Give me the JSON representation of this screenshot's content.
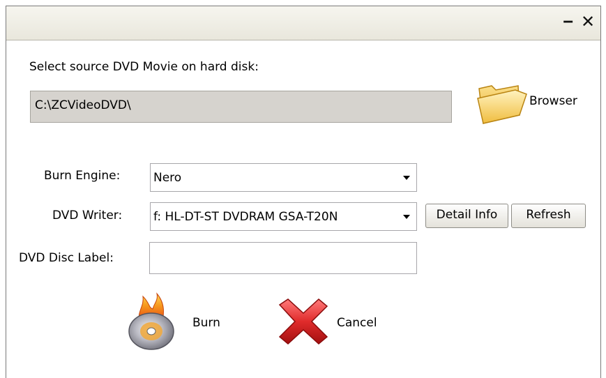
{
  "titlebar": {
    "minimize_glyph": "‒",
    "close_glyph": "✕"
  },
  "source": {
    "label": "Select source DVD Movie on hard disk:",
    "path_value": "C:\\ZCVideoDVD\\",
    "browse_label": "Browser",
    "browse_icon": "folder-icon"
  },
  "burn_engine": {
    "label": "Burn Engine:",
    "selected": "Nero"
  },
  "dvd_writer": {
    "label": "DVD Writer:",
    "selected": "f: HL-DT-ST DVDRAM GSA-T20N",
    "detail_label": "Detail Info",
    "refresh_label": "Refresh"
  },
  "disc_label": {
    "label": "DVD Disc Label:",
    "value": ""
  },
  "actions": {
    "burn_label": "Burn",
    "burn_icon": "burning-disc-icon",
    "cancel_label": "Cancel",
    "cancel_icon": "red-x-icon"
  },
  "colors": {
    "path_bg": "#d6d3ce",
    "titlebar_bg": "#ece9d8",
    "cancel_red": "#e02b2b",
    "folder_yellow": "#f2c54a"
  }
}
